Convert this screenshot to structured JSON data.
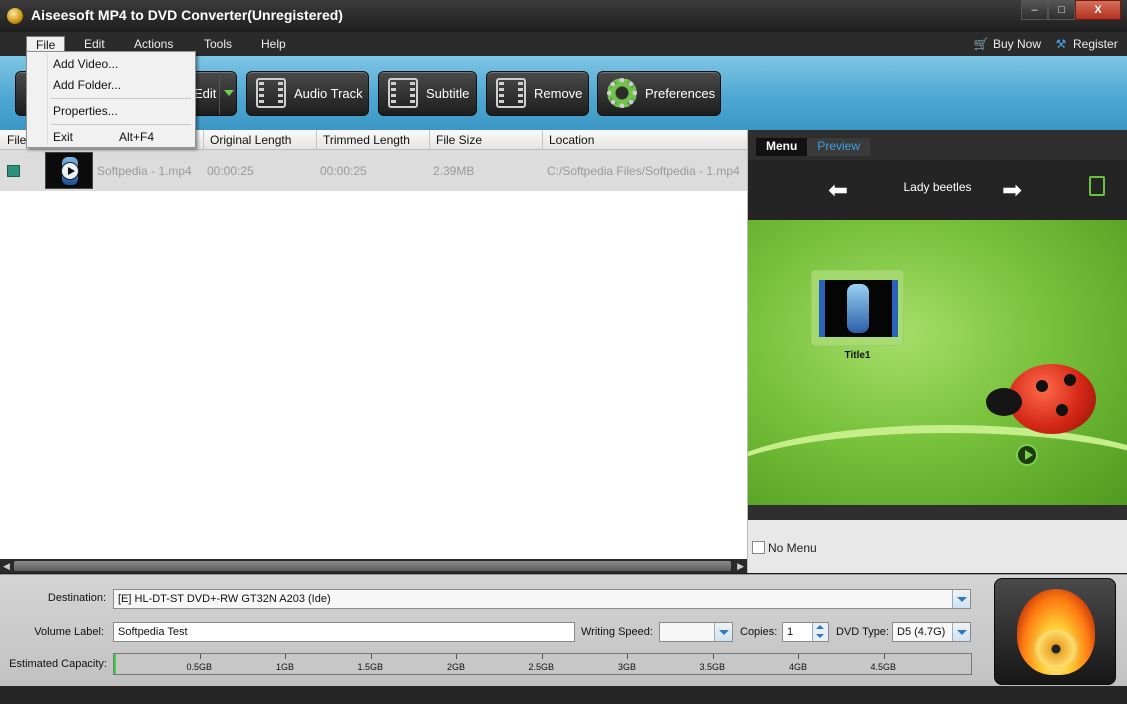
{
  "window": {
    "title": "Aiseesoft MP4 to DVD Converter(Unregistered)",
    "buttons": {
      "minimize": "–",
      "maximize": "□",
      "close": "X"
    }
  },
  "menubar": {
    "items": [
      "File",
      "Edit",
      "Actions",
      "Tools",
      "Help"
    ],
    "buy_now": "Buy Now",
    "register": "Register"
  },
  "file_menu": {
    "add_video": "Add Video...",
    "add_folder": "Add Folder...",
    "properties": "Properties...",
    "exit": "Exit",
    "exit_shortcut": "Alt+F4"
  },
  "toolbar": {
    "edit": "Edit",
    "audio_track": "Audio Track",
    "subtitle": "Subtitle",
    "remove": "Remove",
    "preferences": "Preferences"
  },
  "filelist": {
    "columns": [
      "File",
      "Original Length",
      "Trimmed Length",
      "File Size",
      "Location"
    ],
    "rows": [
      {
        "name": "Softpedia - 1.mp4",
        "original_length": "00:00:25",
        "trimmed_length": "00:00:25",
        "file_size": "2.39MB",
        "location": "C:/Softpedia Files/Softpedia - 1.mp4"
      }
    ]
  },
  "preview": {
    "tab_menu": "Menu",
    "tab_preview": "Preview",
    "template_name": "Lady beetles",
    "title_label": "Title1",
    "no_menu": "No Menu",
    "no_menu_checked": false
  },
  "bottom": {
    "destination_label": "Destination:",
    "destination_value": "[E] HL-DT-ST DVD+-RW GT32N A203 (Ide)",
    "volume_label_label": "Volume Label:",
    "volume_label_value": "Softpedia Test",
    "writing_speed_label": "Writing Speed:",
    "writing_speed_value": "",
    "copies_label": "Copies:",
    "copies_value": "1",
    "dvd_type_label": "DVD Type:",
    "dvd_type_value": "D5 (4.7G)",
    "capacity_label": "Estimated Capacity:",
    "capacity_ticks": [
      "0.5GB",
      "1GB",
      "1.5GB",
      "2GB",
      "2.5GB",
      "3GB",
      "3.5GB",
      "4GB",
      "4.5GB"
    ],
    "capacity_used_gb": 0.00239
  },
  "colors": {
    "toolbar": "#4fa8d3",
    "accent_blue": "#3ea2e6",
    "capacity_fill": "#39d14a",
    "close_button": "#c0402a"
  }
}
